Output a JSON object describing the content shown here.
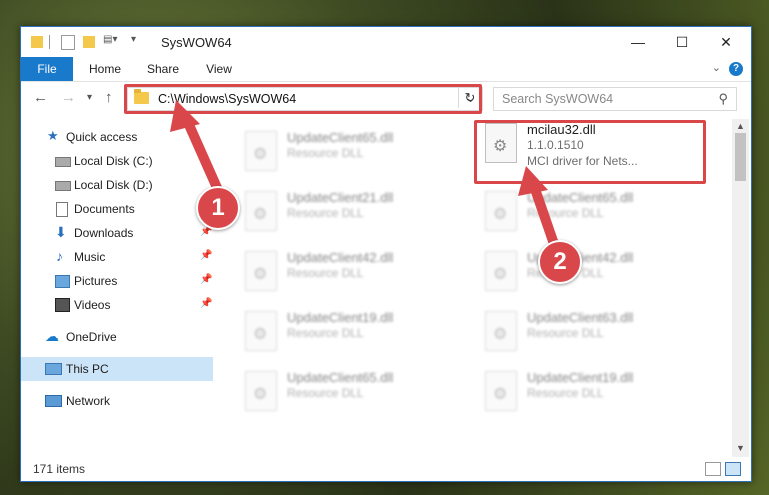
{
  "window": {
    "title": "SysWOW64"
  },
  "ribbon": {
    "tabs": [
      "File",
      "Home",
      "Share",
      "View"
    ],
    "help": "?"
  },
  "address": {
    "path": "C:\\Windows\\SysWOW64"
  },
  "search": {
    "placeholder": "Search SysWOW64"
  },
  "sidebar": {
    "items": [
      {
        "label": "Quick access",
        "icon": "star-icon"
      },
      {
        "label": "Local Disk (C:)",
        "icon": "drive-icon"
      },
      {
        "label": "Local Disk (D:)",
        "icon": "drive-icon"
      },
      {
        "label": "Documents",
        "icon": "documents-icon"
      },
      {
        "label": "Downloads",
        "icon": "download-icon"
      },
      {
        "label": "Music",
        "icon": "music-icon"
      },
      {
        "label": "Pictures",
        "icon": "pictures-icon"
      },
      {
        "label": "Videos",
        "icon": "videos-icon"
      },
      {
        "label": "OneDrive",
        "icon": "cloud-icon"
      },
      {
        "label": "This PC",
        "icon": "computer-icon"
      },
      {
        "label": "Network",
        "icon": "network-icon"
      }
    ]
  },
  "files": {
    "left": [
      {
        "name": "UpdateClient65.dll",
        "type": "Resource DLL"
      },
      {
        "name": "UpdateClient21.dll",
        "type": "Resource DLL"
      },
      {
        "name": "UpdateClient42.dll",
        "type": "Resource DLL"
      },
      {
        "name": "UpdateClient19.dll",
        "type": "Resource DLL"
      },
      {
        "name": "UpdateClient65.dll",
        "type": "Resource DLL"
      }
    ],
    "right": [
      {
        "name": "mcilau32.dll",
        "version": "1.1.0.1510",
        "description": "MCI driver for Nets..."
      },
      {
        "name": "UpdateClient65.dll",
        "type": "Resource DLL"
      },
      {
        "name": "UpdateClient42.dll",
        "type": "Resource DLL"
      },
      {
        "name": "UpdateClient63.dll",
        "type": "Resource DLL"
      },
      {
        "name": "UpdateClient19.dll",
        "type": "Resource DLL"
      }
    ]
  },
  "status": {
    "items": "171 items"
  },
  "annotations": {
    "badge1": "1",
    "badge2": "2",
    "color": "#d9474a"
  }
}
